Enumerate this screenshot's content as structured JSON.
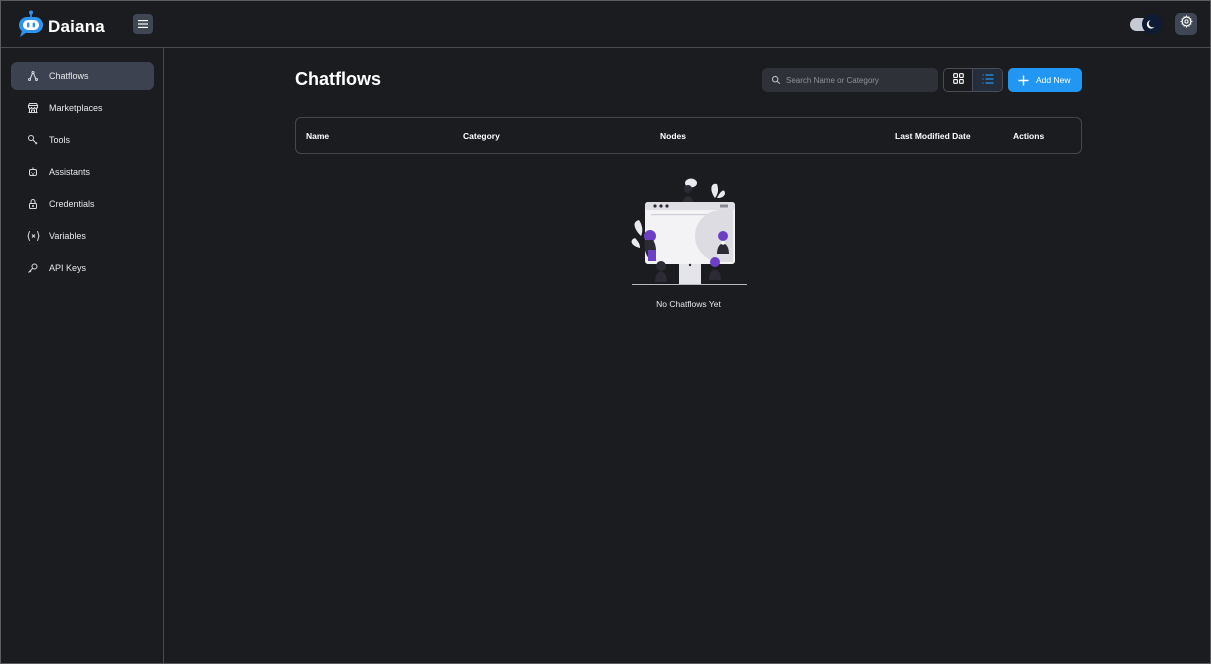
{
  "app": {
    "brand": "Daiana"
  },
  "sidebar": {
    "items": [
      {
        "label": "Chatflows",
        "icon": "hierarchy-icon",
        "active": true
      },
      {
        "label": "Marketplaces",
        "icon": "building-store-icon",
        "active": false
      },
      {
        "label": "Tools",
        "icon": "tool-icon",
        "active": false
      },
      {
        "label": "Assistants",
        "icon": "robot-icon",
        "active": false
      },
      {
        "label": "Credentials",
        "icon": "lock-icon",
        "active": false
      },
      {
        "label": "Variables",
        "icon": "variable-icon",
        "active": false
      },
      {
        "label": "API Keys",
        "icon": "key-icon",
        "active": false
      }
    ]
  },
  "main": {
    "title": "Chatflows",
    "search": {
      "placeholder": "Search Name or Category",
      "value": ""
    },
    "view_mode": "list",
    "add_button": "Add New",
    "table": {
      "columns": [
        "Name",
        "Category",
        "Nodes",
        "Last Modified Date",
        "Actions"
      ],
      "rows": []
    },
    "empty_text": "No Chatflows Yet"
  },
  "colors": {
    "background": "#1b1c20",
    "accent": "#2196f3",
    "brand_blue": "#2f93f0",
    "illustration_purple": "#6c3fc5"
  }
}
